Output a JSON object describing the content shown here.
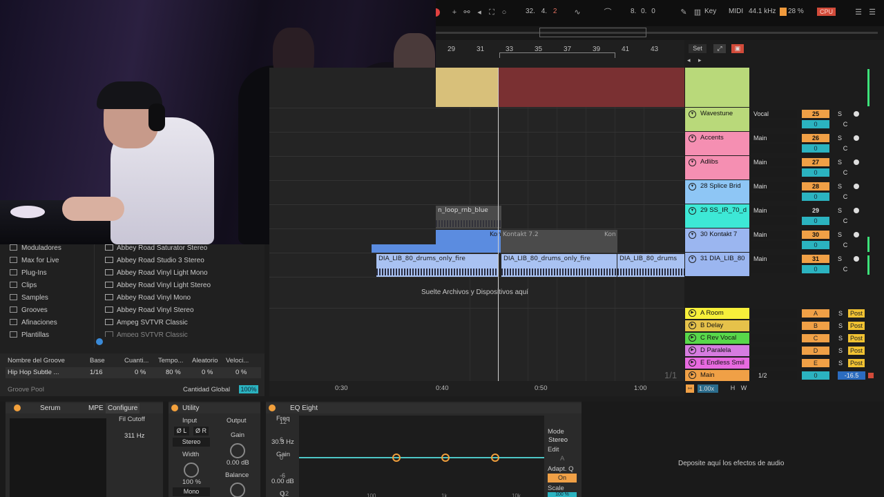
{
  "toolbar": {
    "position": "32.  4.  2",
    "position_bar": "32.",
    "position_beat": "4.",
    "position_sixteenth": "2",
    "loop_length": "8.  0.  0",
    "key_label": "Key",
    "midi_label": "MIDI",
    "sample_rate": "44.1 kHz",
    "cpu_percent": "28 %",
    "cpu_label": "CPU"
  },
  "ruler": {
    "marks": [
      "29",
      "31",
      "33",
      "35",
      "37",
      "39",
      "41",
      "43"
    ]
  },
  "set_panel": {
    "set_label": "Set"
  },
  "tracks": [
    {
      "name": "Wavestune",
      "routing": "Vocal",
      "number": "25",
      "volume": "0",
      "color": "#b9d97a"
    },
    {
      "name": "Accents",
      "routing": "Main",
      "number": "26",
      "volume": "0",
      "color": "#f58fb2"
    },
    {
      "name": "Adlibs",
      "routing": "Main",
      "number": "27",
      "volume": "0",
      "color": "#f58fb2"
    },
    {
      "name": "28 Splice Brid",
      "routing": "Main",
      "number": "28",
      "volume": "0",
      "color": "#8ec6f5"
    },
    {
      "name": "29 SS_IR_70_d",
      "routing": "Main",
      "number": "29",
      "volume": "0",
      "color": "#3de8d6"
    },
    {
      "name": "30 Kontakt 7",
      "routing": "Main",
      "number": "30",
      "volume": "0",
      "color": "#9bb6f0"
    },
    {
      "name": "31 DIA_LIB_80",
      "routing": "Main",
      "number": "31",
      "volume": "0",
      "color": "#9bb6f0"
    }
  ],
  "track_controls": {
    "solo": "S",
    "cue": "C"
  },
  "returns": [
    {
      "name": "A Room",
      "letter": "A",
      "color": "#f7f03a"
    },
    {
      "name": "B Delay",
      "letter": "B",
      "color": "#e6c24a"
    },
    {
      "name": "C Rev Vocal",
      "letter": "C",
      "color": "#58d84a"
    },
    {
      "name": "D Paralela",
      "letter": "D",
      "color": "#d67ce0"
    },
    {
      "name": "E Endless Smil",
      "letter": "E",
      "color": "#e86ae0"
    }
  ],
  "return_controls": {
    "solo": "S",
    "post": "Post"
  },
  "main_track": {
    "name": "Main",
    "routing": "1/2",
    "volume": "0",
    "pan": "-16.5"
  },
  "arrangement": {
    "clips": {
      "rnb": "n_loop_rnb_blue",
      "kontakt_a": "Kon",
      "kontakt_b": "Kontakt 7.2",
      "kontakt_c": "Kon",
      "drums_a": "DIA_LIB_80_drums_only_fire",
      "drums_b": "DIA_LIB_80_drums_only_fire",
      "drums_c": "DIA_LIB_80_drums"
    },
    "drop_text": "Suelte Archivos y Dispositivos aquí",
    "page_indicator": "1/1",
    "time_marks": [
      "0:30",
      "0:40",
      "0:50",
      "1:00"
    ],
    "zoom": "1.00x",
    "h_btn": "H",
    "w_btn": "W"
  },
  "browser": {
    "categories": [
      "Moduladores",
      "Max for Live",
      "Plug-Ins",
      "Clips",
      "Samples",
      "Grooves",
      "Afinaciones",
      "Plantillas"
    ],
    "items": [
      "Abbey Road Saturator Stereo",
      "Abbey Road Studio 3 Stereo",
      "Abbey Road Vinyl Light Mono",
      "Abbey Road Vinyl Light Stereo",
      "Abbey Road Vinyl Mono",
      "Abbey Road Vinyl Stereo",
      "Ampeg SVTVR Classic",
      "Ampeg SVTVR Classic"
    ]
  },
  "groove": {
    "headers": [
      "Nombre del Groove",
      "Base",
      "Cuanti...",
      "Tempo...",
      "Aleatorio",
      "Veloci..."
    ],
    "row": {
      "name": "Hip Hop Subtle ...",
      "base": "1/16",
      "quantize": "0 %",
      "timing": "80 %",
      "random": "0 %",
      "velocity": "0 %"
    },
    "pool_label": "Groove Pool",
    "global_label": "Cantidad Global",
    "global_value": "100%"
  },
  "devices": {
    "serum": {
      "title": "Serum",
      "mpe": "MPE",
      "configure": "Configure",
      "param": "Fil Cutoff",
      "value": "311 Hz"
    },
    "utility": {
      "title": "Utility",
      "input": "Input",
      "output": "Output",
      "phase_l": "Ø L",
      "phase_r": "Ø R",
      "mode": "Stereo",
      "gain_label": "Gain",
      "gain_value": "0.00 dB",
      "width_label": "Width",
      "width_value": "100 %",
      "balance_label": "Balance",
      "mono": "Mono"
    },
    "eq": {
      "title": "EQ Eight",
      "freq_label": "Freq",
      "freq_value": "30.3 Hz",
      "gain_label": "Gain",
      "gain_value": "0.00 dB",
      "q_label": "Q",
      "scale": [
        "12",
        "6",
        "0",
        "-6",
        "-12"
      ],
      "freqs": [
        "100",
        "1k",
        "10k"
      ],
      "mode_label": "Mode",
      "mode_value": "Stereo",
      "edit_label": "Edit",
      "edit_value": "A",
      "adapt_label": "Adapt. Q",
      "adapt_value": "On",
      "scale_label": "Scale",
      "scale_value": "100 %"
    },
    "drop_fx": "Deposite aquí los efectos de audio"
  }
}
